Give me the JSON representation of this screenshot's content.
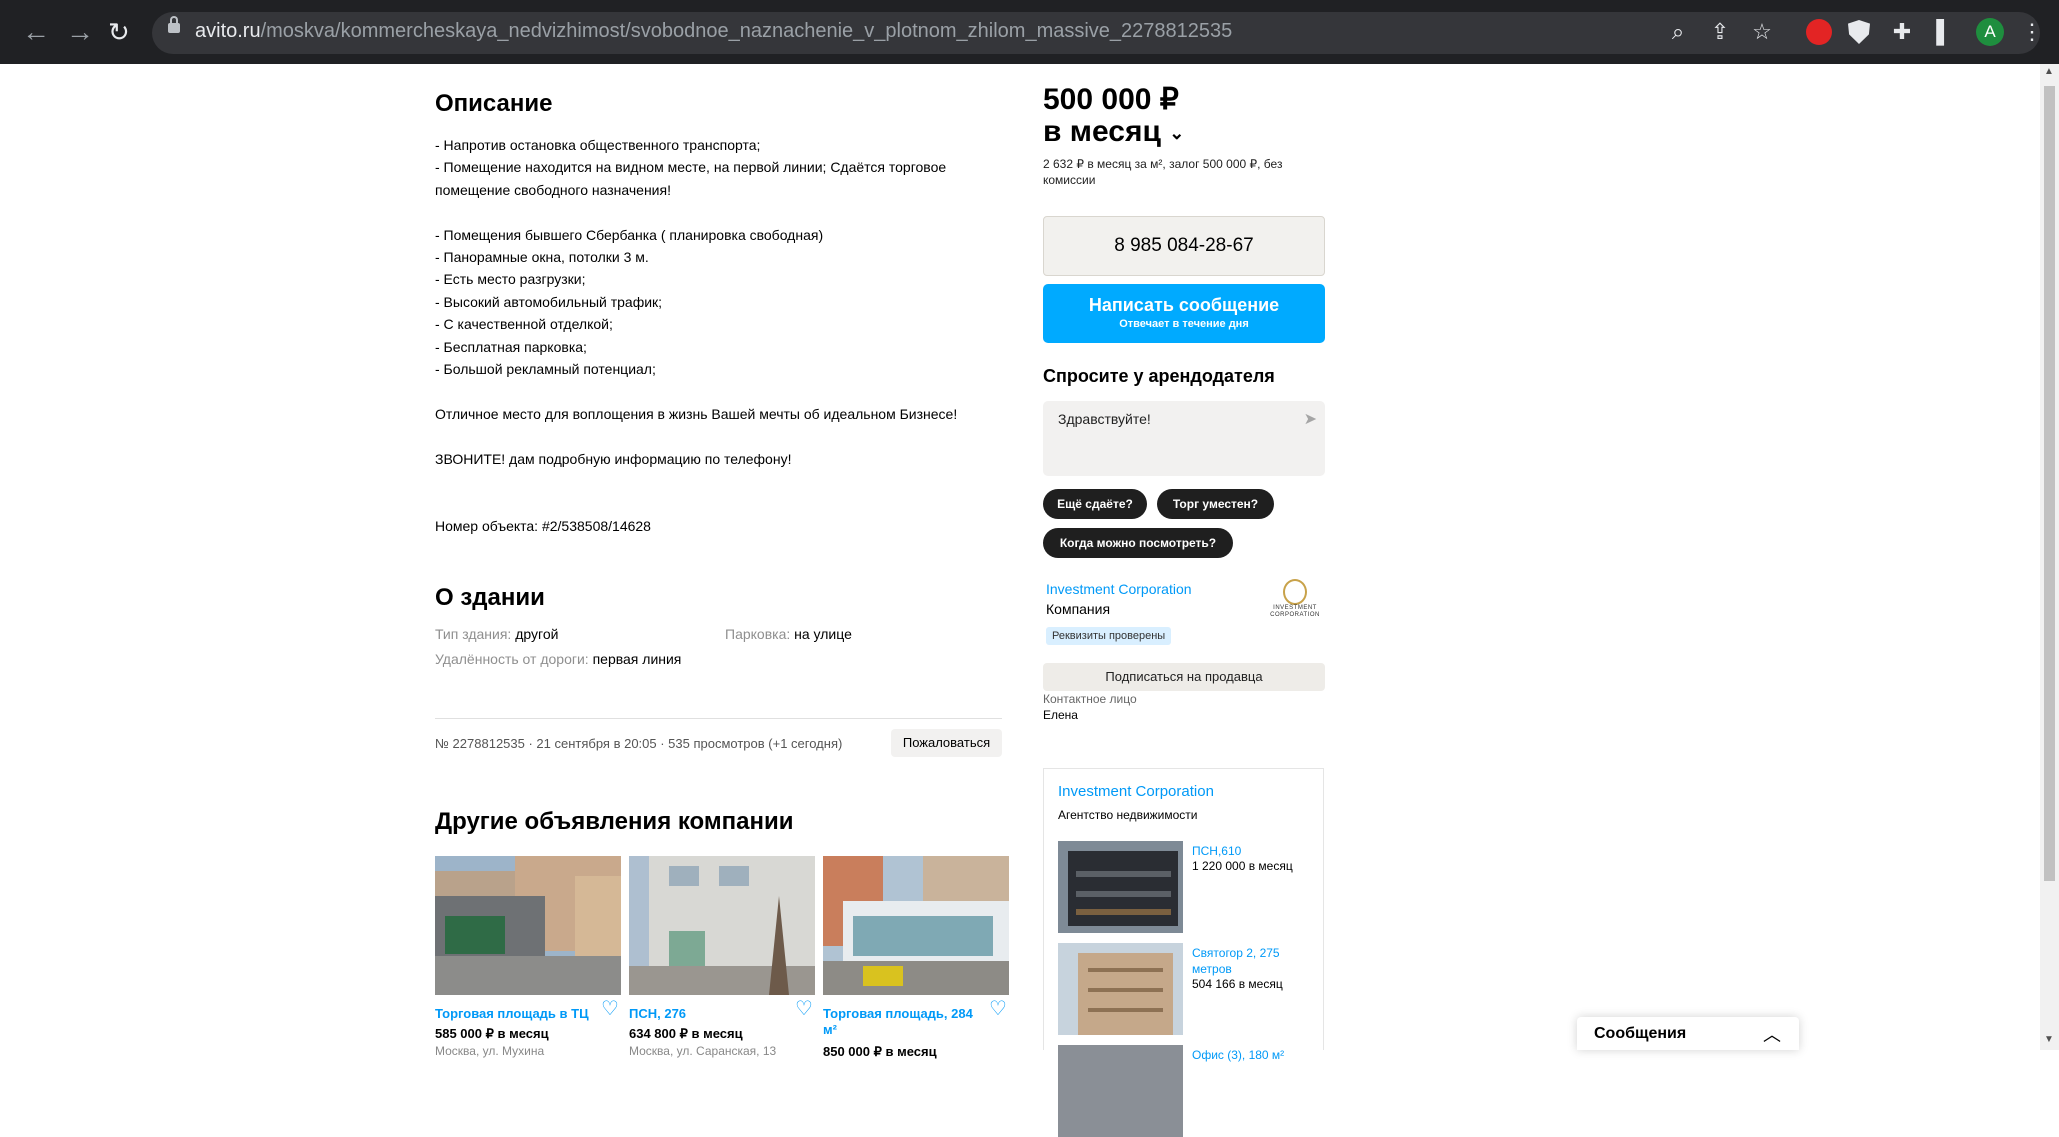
{
  "browser": {
    "url_host": "avito.ru",
    "url_path": "/moskva/kommercheskaya_nedvizhimost/svobodnoe_naznachenie_v_plotnom_zhilom_massive_2278812535",
    "profile_initial": "A"
  },
  "description": {
    "heading": "Описание",
    "text": "- Напротив остановка общественного транспорта;\n- Помещение находится на видном месте, на первой линии; Сдаётся торговое помещение свободного назначения!\n\n- Помещения бывшего Сбербанка ( планировка свободная)\n- Панорамные окна, потолки 3 м.\n- Есть место разгрузки;\n- Высокий автомобильный трафик;\n- С качественной отделкой;\n- Бесплатная парковка;\n- Большой рекламный потенциал;\n\nОтличное место для воплощения в жизнь Вашей мечты об идеальном Бизнесе!\n\nЗВОНИТЕ! дам подробную информацию по телефону!\n\n\nНомер объекта: #2/538508/14628"
  },
  "building": {
    "heading": "О здании",
    "facts": [
      {
        "label": "Тип здания:",
        "value": "другой"
      },
      {
        "label": "Парковка:",
        "value": "на улице"
      },
      {
        "label": "Удалённость от дороги:",
        "value": "первая линия"
      }
    ]
  },
  "meta": {
    "text": "№ 2278812535 · 21 сентября в 20:05 · 535 просмотров (+1 сегодня)",
    "complain": "Пожаловаться"
  },
  "other_ads": {
    "heading": "Другие объявления компании",
    "items": [
      {
        "title": "Торговая площадь в ТЦ",
        "price": "585 000 ₽ в месяц",
        "address": "Москва, ул. Мухина"
      },
      {
        "title": "ПСН, 276",
        "price": "634 800 ₽ в месяц",
        "address": "Москва, ул. Саранская, 13"
      },
      {
        "title": "Торговая площадь, 284 м²",
        "price": "850 000 ₽ в месяц",
        "address": ""
      }
    ]
  },
  "sidebar": {
    "price_line1": "500 000 ₽",
    "price_line2": "в месяц",
    "price_sub": "2 632 ₽ в месяц за м², залог 500 000 ₽, без комиссии",
    "phone": "8 985 084-28-67",
    "message_button": "Написать сообщение",
    "message_sub": "Отвечает в течение дня",
    "ask_heading": "Спросите у арендодателя",
    "ask_placeholder": "Здравствуйте!",
    "chips": [
      "Ещё сдаёте?",
      "Торг уместен?",
      "Когда можно посмотреть?"
    ],
    "seller_name": "Investment Corporation",
    "seller_type": "Компания",
    "verified": "Реквизиты проверены",
    "logo_text": "INVESTMENT CORPORATION",
    "subscribe": "Подписаться на продавца",
    "contact_label": "Контактное лицо",
    "contact_name": "Елена"
  },
  "agency": {
    "name": "Investment Corporation",
    "type": "Агентство недвижимости",
    "items": [
      {
        "title": "ПСН,610",
        "price": "1 220 000 в месяц"
      },
      {
        "title": "Святогор 2, 275 метров",
        "price": "504 166 в месяц"
      },
      {
        "title": "Офис (3), 180 м²",
        "price": ""
      }
    ]
  },
  "messages_widget": {
    "label": "Сообщения"
  },
  "colors": {
    "accent": "#00aaff",
    "link": "#0099f7",
    "chrome": "#202124"
  },
  "icons": [
    "back-icon",
    "forward-icon",
    "reload-icon",
    "lock-icon",
    "zoom-icon",
    "share-icon",
    "star-icon",
    "extension-icon",
    "sidepanel-icon",
    "kebab-icon",
    "send-icon",
    "heart-icon",
    "chevron-up-icon"
  ]
}
